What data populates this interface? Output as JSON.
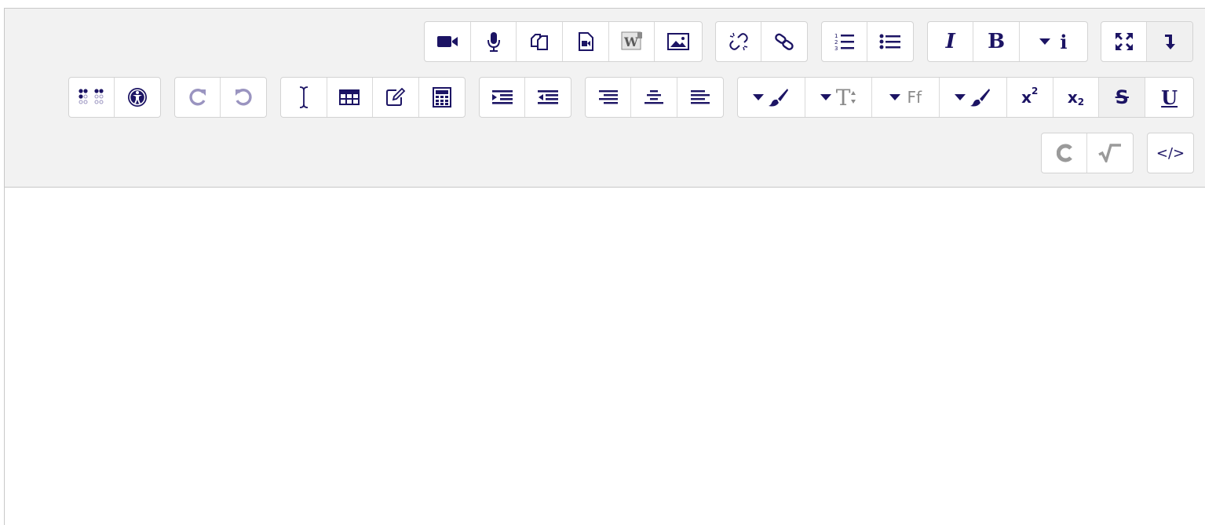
{
  "toolbar": {
    "media_group": [
      {
        "name": "video-icon"
      },
      {
        "name": "microphone-icon"
      },
      {
        "name": "manage-files-icon"
      },
      {
        "name": "media-file-icon"
      },
      {
        "name": "paste-word-icon",
        "label": "W"
      },
      {
        "name": "image-icon"
      }
    ],
    "link_group": [
      {
        "name": "unlink-icon"
      },
      {
        "name": "link-icon"
      }
    ],
    "list_group": [
      {
        "name": "ordered-list-icon"
      },
      {
        "name": "unordered-list-icon"
      }
    ],
    "style_group": {
      "italic_label": "I",
      "bold_label": "B",
      "info_label": "i"
    },
    "fullscreen_group": [
      {
        "name": "fullscreen-icon"
      },
      {
        "name": "expand-toolbar-icon"
      }
    ],
    "row2": {
      "accessibility_group": [
        {
          "name": "braille-icon"
        },
        {
          "name": "accessibility-checker-icon"
        }
      ],
      "history_group": [
        {
          "name": "redo-icon"
        },
        {
          "name": "undo-icon"
        }
      ],
      "insert_group": [
        {
          "name": "insert-char-icon"
        },
        {
          "name": "table-icon"
        },
        {
          "name": "edit-icon"
        },
        {
          "name": "calculator-icon"
        }
      ],
      "indent_group": [
        {
          "name": "indent-icon"
        },
        {
          "name": "outdent-icon"
        }
      ],
      "align_group": [
        {
          "name": "align-right-icon"
        },
        {
          "name": "align-center-icon"
        },
        {
          "name": "align-left-icon"
        }
      ],
      "font_group": {
        "font_size_label": "T",
        "font_family_label": "Ff",
        "superscript_label": "x",
        "superscript_mark": "2",
        "subscript_label": "x",
        "subscript_mark": "2",
        "strike_label": "S",
        "underline_label": "U"
      }
    },
    "row3": {
      "math_group": [
        {
          "name": "chemistry-icon"
        },
        {
          "name": "equation-icon"
        }
      ],
      "html_group": {
        "label": "</>"
      }
    }
  },
  "colors": {
    "icon": "#1c1464",
    "toolbar_bg": "#f2f2f2",
    "border": "#d3d3d3"
  }
}
